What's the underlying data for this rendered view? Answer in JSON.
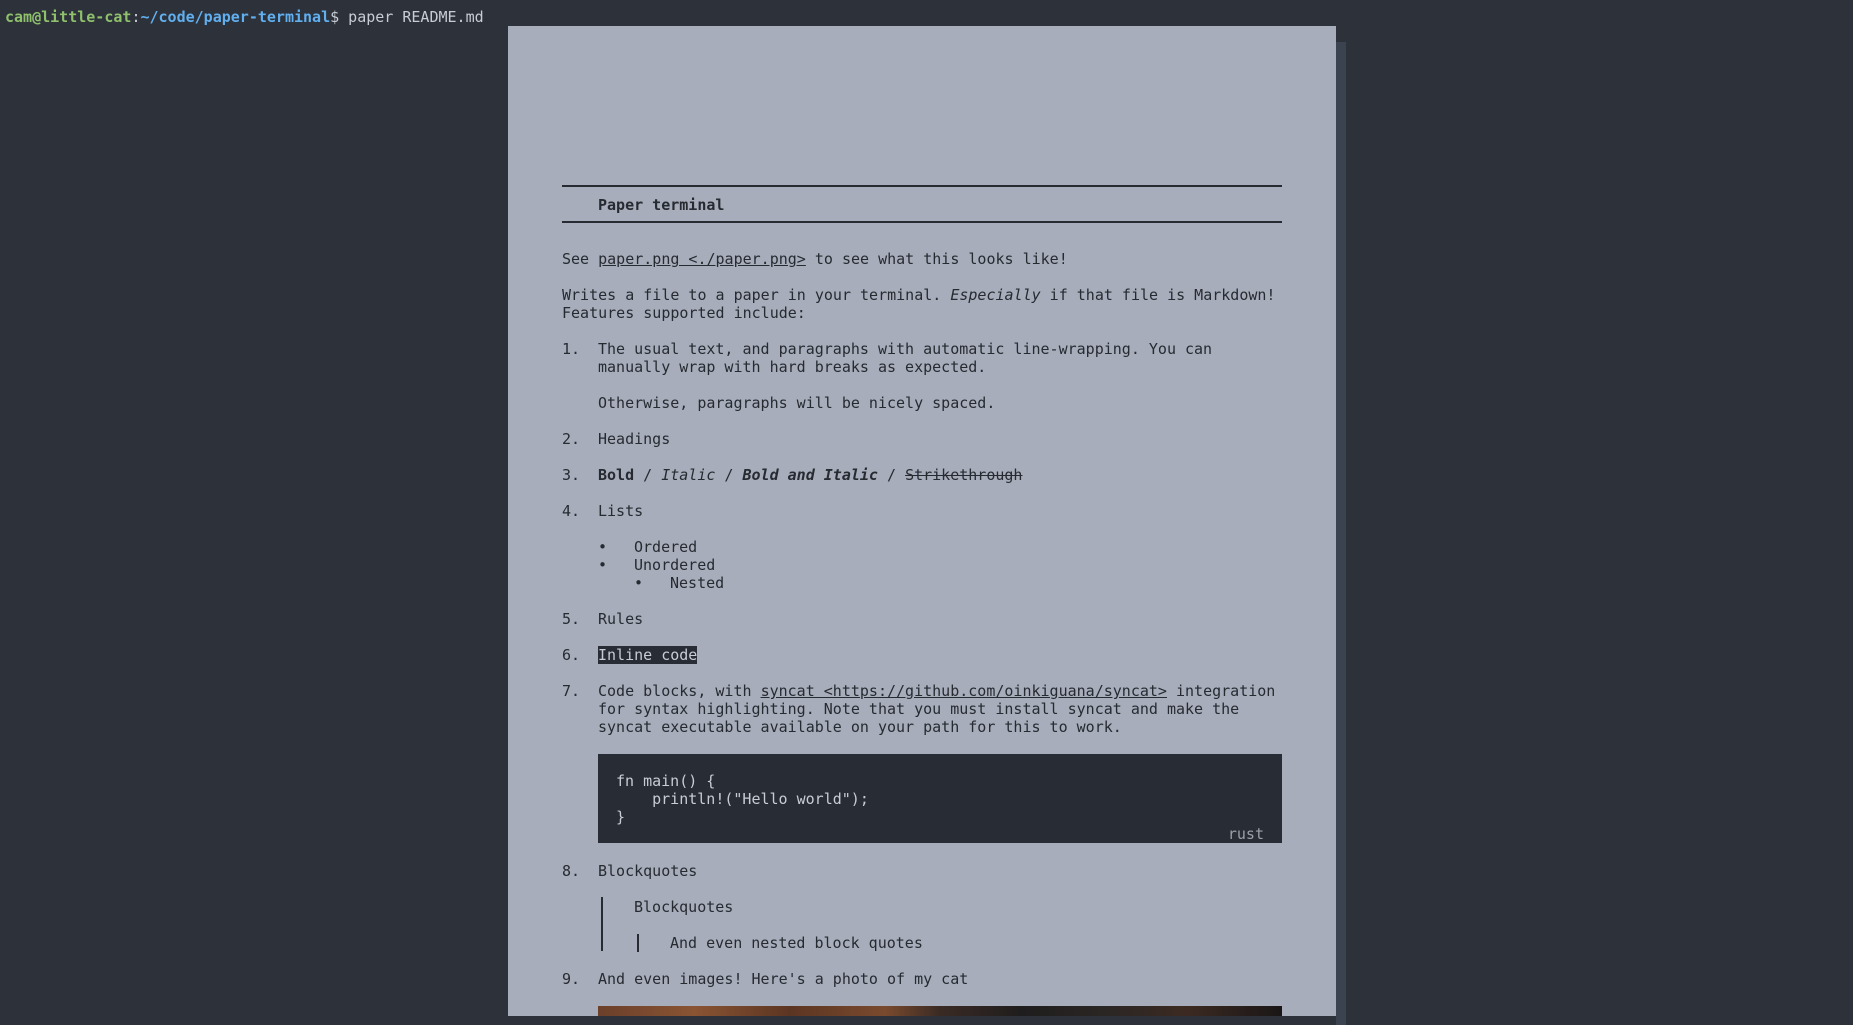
{
  "terminal": {
    "user_host": "cam@little-cat",
    "colon": ":",
    "path": "~/code/paper-terminal",
    "prompt_symbol": "$",
    "command": " paper README.md"
  },
  "doc": {
    "title": "Paper terminal",
    "see_prefix": "See ",
    "see_link": "paper.png <./paper.png>",
    "see_suffix": " to see what this looks like!",
    "intro1_a": "Writes a file to a paper in your terminal. ",
    "intro1_em": "Especially",
    "intro1_b": " if that file is Markdown!",
    "intro2": "Features supported include:",
    "items": [
      {
        "num": "1.",
        "line1": "The usual text, and paragraphs with automatic line-wrapping. You can",
        "line2": "manually wrap with hard breaks as expected.",
        "line3": "Otherwise, paragraphs will be nicely spaced."
      },
      {
        "num": "2.",
        "text": "Headings"
      },
      {
        "num": "3.",
        "bold": "Bold",
        "sep1": " / ",
        "italic": "Italic",
        "sep2": " / ",
        "bolditalic": "Bold and Italic",
        "sep3": " / ",
        "strike": "Strikethrough"
      },
      {
        "num": "4.",
        "text": "Lists",
        "sub": [
          {
            "bullet": "•",
            "text": "Ordered"
          },
          {
            "bullet": "•",
            "text": "Unordered"
          },
          {
            "bullet": "•",
            "text": "Nested"
          }
        ]
      },
      {
        "num": "5.",
        "text": "Rules"
      },
      {
        "num": "6.",
        "text": "Inline code"
      },
      {
        "num": "7.",
        "line1_a": "Code blocks, with ",
        "line1_link": "syncat <https://github.com/oinkiguana/syncat>",
        "line1_b": " integration",
        "line2": "for syntax highlighting. Note that you must install syncat and make the",
        "line3": "syncat executable available on your path for this to work."
      },
      {
        "num": "8.",
        "text": "Blockquotes",
        "quote1": "Blockquotes",
        "quote2": "And even nested block quotes"
      },
      {
        "num": "9.",
        "text": "And even images! Here's a photo of my cat"
      }
    ],
    "code": {
      "lines": [
        "fn main() {",
        "    println!(\"Hello world\");",
        "}"
      ],
      "lang": "rust"
    }
  }
}
